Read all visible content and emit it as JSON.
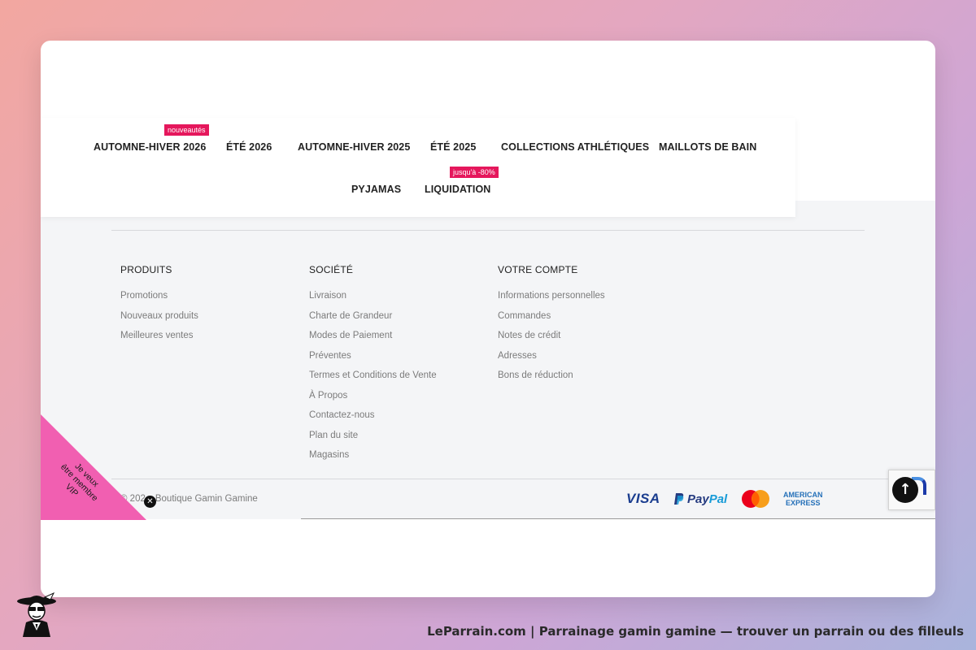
{
  "nav": {
    "items": [
      {
        "label": "AUTOMNE-HIVER 2026",
        "badge": "nouveautés"
      },
      {
        "label": "ÉTÉ 2026"
      },
      {
        "label": "AUTOMNE-HIVER 2025"
      },
      {
        "label": "ÉTÉ 2025"
      },
      {
        "label": "COLLECTIONS ATHLÉTIQUES"
      },
      {
        "label": "MAILLOTS DE BAIN"
      },
      {
        "label": "PYJAMAS"
      },
      {
        "label": "LIQUIDATION",
        "badge": "jusqu'à -80%"
      }
    ]
  },
  "footer": {
    "columns": [
      {
        "title": "PRODUITS",
        "links": [
          "Promotions",
          "Nouveaux produits",
          "Meilleures ventes"
        ]
      },
      {
        "title": "SOCIÉTÉ",
        "links": [
          "Livraison",
          "Charte de Grandeur",
          "Modes de Paiement",
          "Préventes",
          "Termes et Conditions de Vente",
          "À Propos",
          "Contactez-nous",
          "Plan du site",
          "Magasins"
        ]
      },
      {
        "title": "VOTRE COMPTE",
        "links": [
          "Informations personnelles",
          "Commandes",
          "Notes de crédit",
          "Adresses",
          "Bons de réduction"
        ]
      }
    ],
    "copyright": "© 202",
    "copyright_rest": "Boutique Gamin Gamine",
    "payments": {
      "visa": "VISA",
      "paypal_1": "Pay",
      "paypal_2": "Pal",
      "mastercard": "MasterCard",
      "amex_1": "AMERICAN",
      "amex_2": "EXPRESS"
    }
  },
  "vip": {
    "line1": "Je veux",
    "line2": "être membre",
    "line3": "VIP",
    "close_icon": "close-icon"
  },
  "scroll_top": {
    "icon": "↑"
  },
  "close": {
    "icon": "✕"
  },
  "caption": "LeParrain.com | Parrainage gamin gamine — trouver un parrain ou des filleuls",
  "colors": {
    "accent": "#e5175c",
    "vip_pink": "#f15fb1"
  }
}
